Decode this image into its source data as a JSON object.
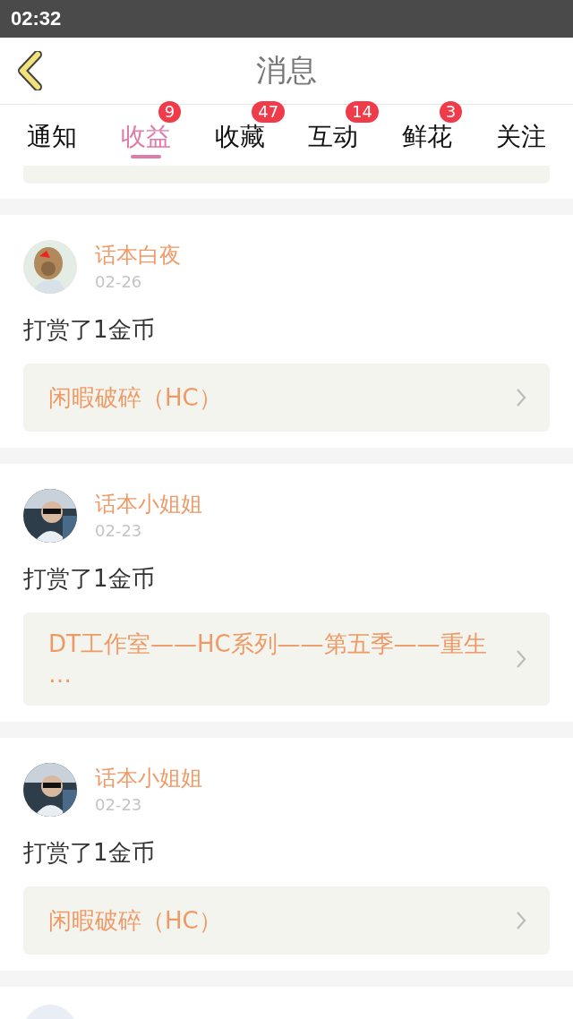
{
  "status_bar": {
    "time": "02:32"
  },
  "header": {
    "title": "消息"
  },
  "tabs": [
    {
      "label": "通知",
      "selected": false
    },
    {
      "label": "收益",
      "selected": true,
      "badge": "9"
    },
    {
      "label": "收藏",
      "selected": false,
      "badge": "47"
    },
    {
      "label": "互动",
      "selected": false,
      "badge": "14"
    },
    {
      "label": "鲜花",
      "selected": false,
      "badge": "3"
    },
    {
      "label": "关注",
      "selected": false
    }
  ],
  "messages": [
    {
      "user": "话本白夜",
      "date": "02-26",
      "text": "打赏了1金币",
      "book_lines": [
        "闲暇破碎（HC）"
      ]
    },
    {
      "user": "话本小姐姐",
      "date": "02-23",
      "text": "打赏了1金币",
      "book_lines": [
        "DT工作室——HC系列——第五季——重生",
        "…"
      ]
    },
    {
      "user": "话本小姐姐",
      "date": "02-23",
      "text": "打赏了1金币",
      "book_lines": [
        "闲暇破碎（HC）"
      ]
    }
  ]
}
